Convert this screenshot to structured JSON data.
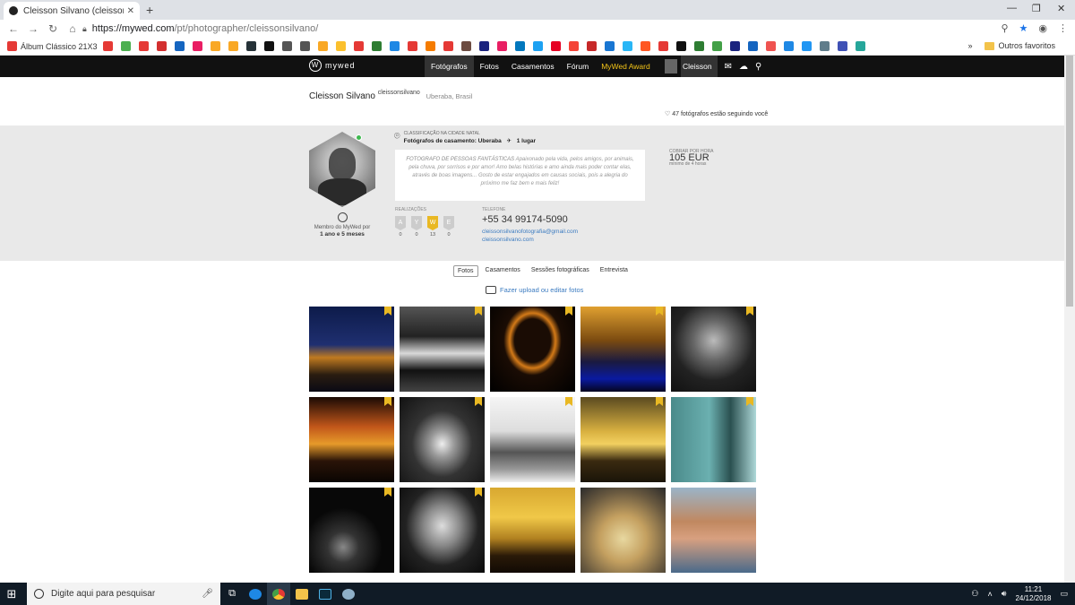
{
  "browser": {
    "tab_title": "Cleisson Silvano (cleissonsilvano) |",
    "url_host": "https://mywed.com",
    "url_path": "/pt/photographer/cleissonsilvano/",
    "bookmark_first": "Álbum Clássico 21X3",
    "bookmark_folder": "Outros favoritos",
    "bookmark_colors": [
      "#e53935",
      "#4caf50",
      "#e53935",
      "#d32f2f",
      "#1565c0",
      "#e91e63",
      "#f9a825",
      "#f9a825",
      "#263238",
      "#111111",
      "#555555",
      "#555555",
      "#f9a825",
      "#fbc02d",
      "#e53935",
      "#2e7d32",
      "#1e88e5",
      "#e53935",
      "#f57c00",
      "#e53935",
      "#6d4c41",
      "#1a237e",
      "#e91e63",
      "#0277bd",
      "#1da1f2",
      "#e60023",
      "#f44336",
      "#c62828",
      "#1976d2",
      "#29b6f6",
      "#ff5722",
      "#e53935",
      "#111111",
      "#2e7d32",
      "#43a047",
      "#1a237e",
      "#1565c0",
      "#ef5350",
      "#1e88e5",
      "#2196f3",
      "#607d8b",
      "#3f51b5",
      "#26a69a"
    ]
  },
  "site": {
    "nav": {
      "logo_text": "mywed",
      "links": [
        "Fotógrafos",
        "Fotos",
        "Casamentos",
        "Fórum"
      ],
      "award": "MyWed Award",
      "user": "Cleisson"
    },
    "profile": {
      "name": "Cleisson Silvano",
      "handle": "cleissonsilvano",
      "location": "Uberaba, Brasil",
      "followers": "47 fotógrafos estão seguindo você",
      "member_label": "Membro do MyWed por",
      "member_duration": "1 ano e 5 meses",
      "ranking_label": "CLASSIFICAÇÃO NA CIDADE NATAL",
      "ranking_category": "Fotógrafos de casamento: Uberaba",
      "ranking_place": "1 lugar",
      "bio_lead": "FOTOGRAFO DE PESSOAS FANTÁSTICAS",
      "bio_rest": " Apaixonado pela vida, pelos amigos, por animais, pela chuva, por sorrisos e por amor! Amo belas histórias e amo ainda mais poder contar elas, através de boas imagens... Gosto de estar engajados em causas sociais, pois a alegria do próximo me faz bem e mais feliz!",
      "price_label": "COBRAR POR HORA",
      "price": "105 EUR",
      "price_min": "mínimo de 4 horas",
      "achievements_label": "REALIZAÇÕES",
      "badges": [
        {
          "letter": "A",
          "count": "0",
          "gold": false
        },
        {
          "letter": "Y",
          "count": "0",
          "gold": false
        },
        {
          "letter": "W",
          "count": "13",
          "gold": true
        },
        {
          "letter": "E",
          "count": "0",
          "gold": false
        }
      ],
      "phone_label": "TELEFONE",
      "phone": "+55 34 99174-5090",
      "email": "cleissonsilvanofotografia@gmail.com",
      "website": "cleissonsilvano.com"
    },
    "tabs": [
      "Fotos",
      "Casamentos",
      "Sessões fotográficas",
      "Entrevista"
    ],
    "upload_link": "Fazer upload ou editar fotos"
  },
  "taskbar": {
    "search_placeholder": "Digite aqui para pesquisar",
    "time": "11:21",
    "date": "24/12/2018"
  }
}
